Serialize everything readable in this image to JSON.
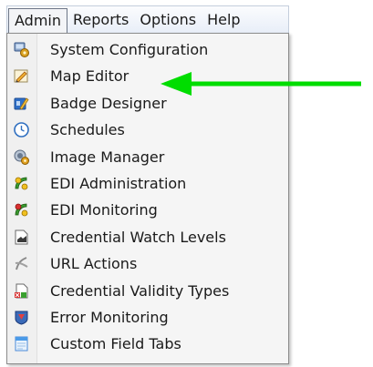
{
  "menubar": {
    "items": [
      {
        "label": "Admin",
        "active": true
      },
      {
        "label": "Reports",
        "active": false
      },
      {
        "label": "Options",
        "active": false
      },
      {
        "label": "Help",
        "active": false
      }
    ]
  },
  "dropdown": {
    "items": [
      {
        "label": "System Configuration",
        "icon": "system-configuration-icon"
      },
      {
        "label": "Map Editor",
        "icon": "map-editor-icon"
      },
      {
        "label": "Badge Designer",
        "icon": "badge-designer-icon"
      },
      {
        "label": "Schedules",
        "icon": "clock-icon"
      },
      {
        "label": "Image Manager",
        "icon": "image-manager-icon"
      },
      {
        "label": "EDI Administration",
        "icon": "edi-administration-icon"
      },
      {
        "label": "EDI Monitoring",
        "icon": "edi-monitoring-icon"
      },
      {
        "label": "Credential Watch Levels",
        "icon": "credential-watch-icon"
      },
      {
        "label": "URL Actions",
        "icon": "url-actions-icon"
      },
      {
        "label": "Credential Validity Types",
        "icon": "credential-validity-icon"
      },
      {
        "label": "Error Monitoring",
        "icon": "error-monitoring-icon"
      },
      {
        "label": "Custom Field Tabs",
        "icon": "custom-field-tabs-icon"
      }
    ]
  },
  "annotation": {
    "arrow_color": "#00dd00",
    "points_to": "Map Editor"
  }
}
